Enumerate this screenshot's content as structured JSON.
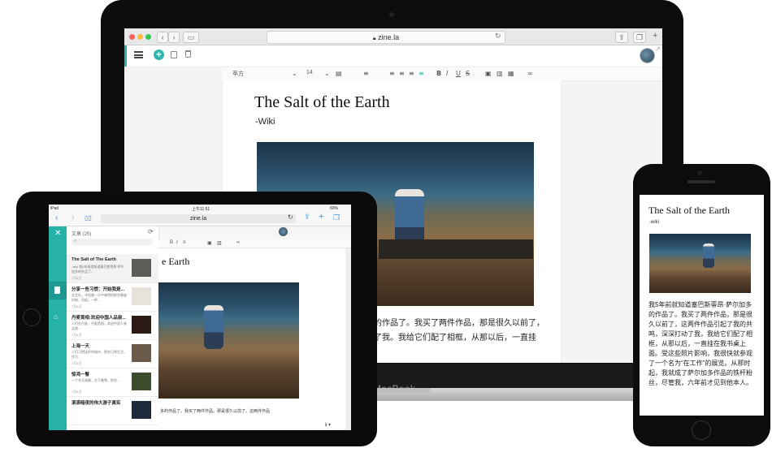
{
  "desktop": {
    "url": "zine.la",
    "font_name": "苹方",
    "font_size": "14",
    "doc_title": "The Salt of the Earth",
    "doc_subtitle": "-Wiki",
    "body_line1": "的作品了。我买了两件作品，那是很久以前了，",
    "body_line2": "了我。我给它们配了相框，从那以后，一直挂",
    "brand": "MacBook"
  },
  "tablet": {
    "status_device": "iPad",
    "status_time": "上午11:51",
    "status_battery": "60%",
    "url": "zine.la",
    "panel_title": "文章 (25)",
    "doc_title_partial": "e Earth",
    "body_text": "多的作品了。我买了两件作品，那是很久以前了。这两件作品",
    "articles": [
      {
        "title": "The Salt of The Earth",
        "excerpt": "-wiki 我5年前就知道塞巴斯蒂昂·萨尔加多的作品了...",
        "date": "7月4日"
      },
      {
        "title": "分享一些习惯：开始我是...",
        "excerpt": "总会在，寻找着一天中难得的那些静谧时刻，早起，一杯...",
        "date": "7月4日"
      },
      {
        "title": "丹麦首相:欢迎中国人品尝...",
        "excerpt": "人们在丹麦，丹麦首相，欢迎中国人来品尝...",
        "date": "7月4日"
      },
      {
        "title": "上海一天",
        "excerpt": "人们习惯这样的城市，那些日常生活，作为...",
        "date": "7月4日"
      },
      {
        "title": "惊鸿一瞥",
        "excerpt": "一个冬天清晨，在下着雪，那些...",
        "date": "7月4日"
      },
      {
        "title": "滚滚暗夜的伟大游子真实",
        "excerpt": "",
        "date": ""
      }
    ]
  },
  "phone": {
    "doc_title": "The Salt of the Earth",
    "doc_subtitle": "-wiki",
    "body_text": "我5年前就知道塞巴斯蒂昂·萨尔加多的作品了。我买了两件作品，那是很久以前了，这两件作品引起了我的共鸣，深深打动了我，我给它们配了相框，从那以后，一直挂在我书桌上面。受这些照片影响，我很快就参观了一个名为“在工作”的展览。从那时起，我就成了萨尔加多作品的铁杆粉丝，尽管我，六年前才见到他本人。"
  },
  "colors": {
    "accent": "#2fb5ad",
    "sidebar": "#26b2a9"
  }
}
